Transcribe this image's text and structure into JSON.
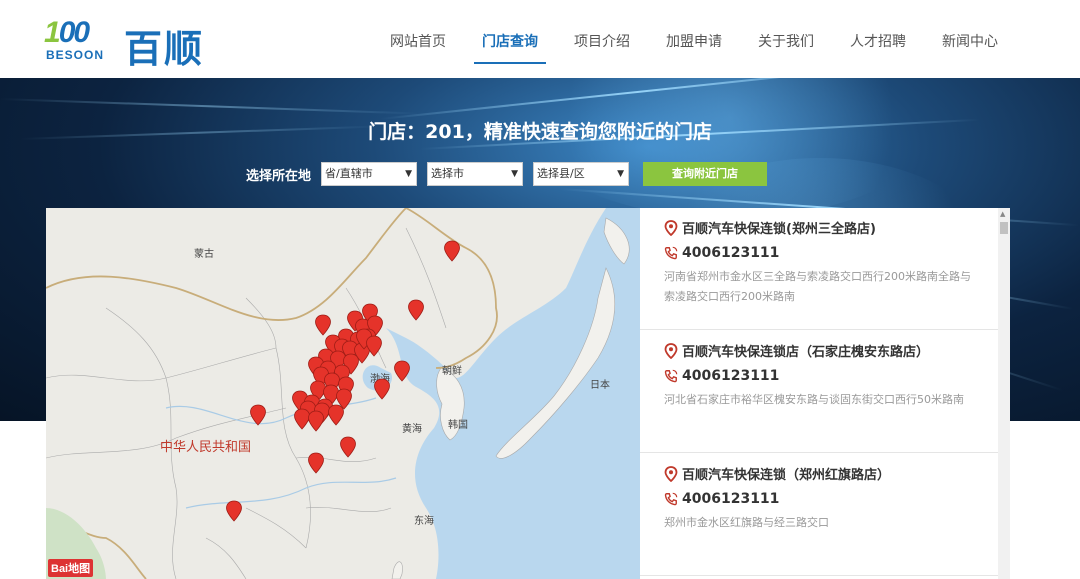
{
  "logo": {
    "number_part1": "1",
    "number_part2": "00",
    "sub": "BESOON",
    "cn": "百顺"
  },
  "nav": [
    {
      "label": "网站首页",
      "active": false
    },
    {
      "label": "门店查询",
      "active": true
    },
    {
      "label": "项目介绍",
      "active": false
    },
    {
      "label": "加盟申请",
      "active": false
    },
    {
      "label": "关于我们",
      "active": false
    },
    {
      "label": "人才招聘",
      "active": false
    },
    {
      "label": "新闻中心",
      "active": false
    }
  ],
  "banner": {
    "headline": "门店：201，精准快速查询您附近的门店",
    "location_label": "选择所在地",
    "selects": [
      {
        "value": "省/直辖市"
      },
      {
        "value": "选择市"
      },
      {
        "value": "选择县/区"
      }
    ],
    "query_button": "查询附近门店"
  },
  "map": {
    "labels": {
      "mongolia": "蒙古",
      "china": "中华人民共和国",
      "north_korea": "朝鲜",
      "south_korea": "韩国",
      "japan": "日本",
      "bohai": "渤海",
      "yellow_sea": "黄海",
      "east_sea": "东海"
    },
    "provider_logo": "Bai地图"
  },
  "stores": [
    {
      "name": "百顺汽车快保连锁(郑州三全路店)",
      "phone": "4006123111",
      "address": "河南省郑州市金水区三全路与索凌路交口西行200米路南全路与索凌路交口西行200米路南"
    },
    {
      "name": "百顺汽车快保连锁店（石家庄槐安东路店）",
      "phone": "4006123111",
      "address": "河北省石家庄市裕华区槐安东路与谈固东街交口西行50米路南"
    },
    {
      "name": "百顺汽车快保连锁（郑州红旗路店）",
      "phone": "4006123111",
      "address": "郑州市金水区红旗路与经三路交口"
    }
  ],
  "colors": {
    "brand_blue": "#1a6fb8",
    "brand_green": "#8bc53f",
    "pin_red": "#e5332a"
  }
}
